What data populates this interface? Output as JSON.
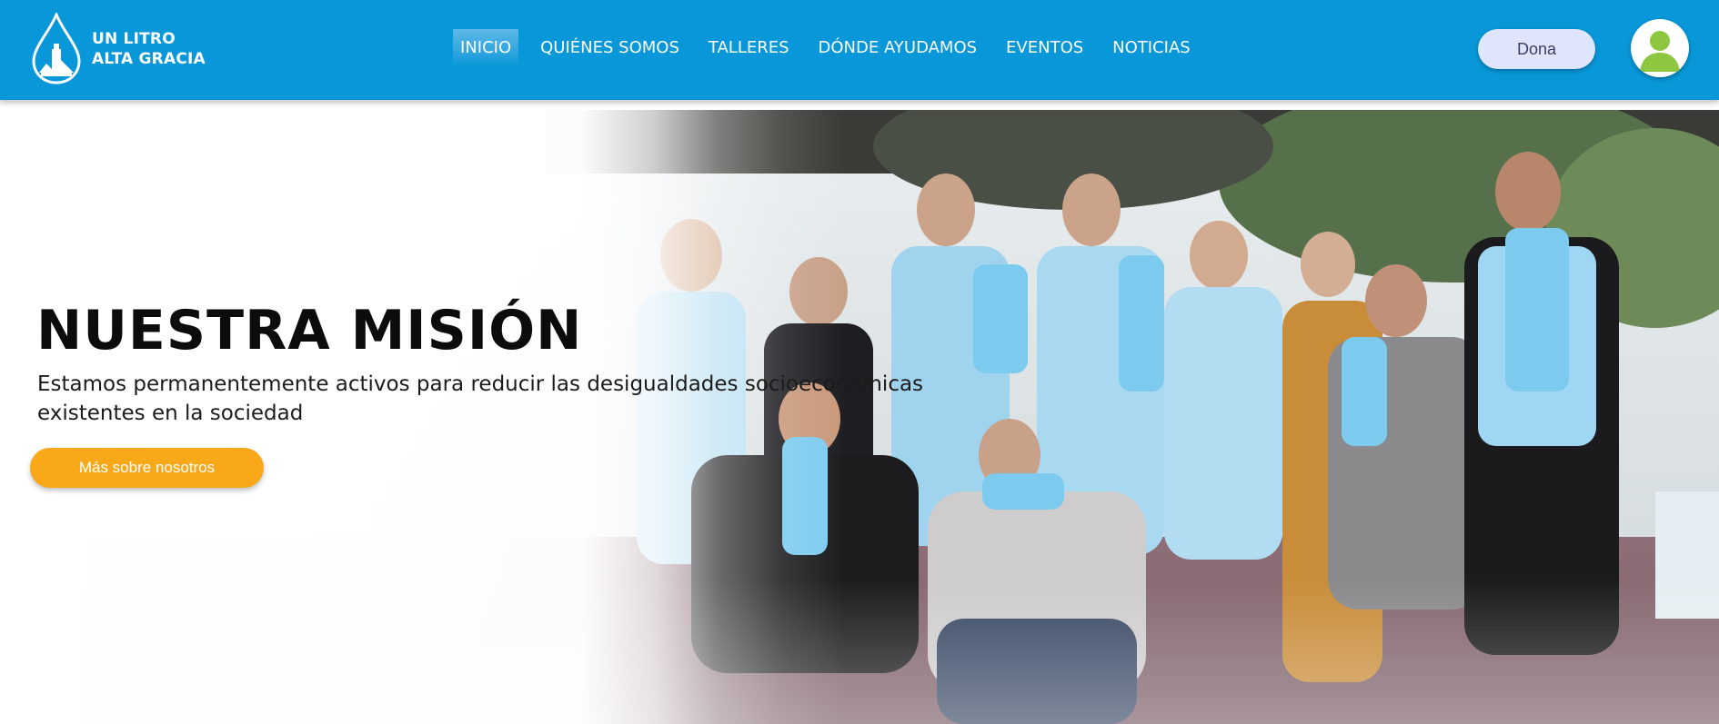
{
  "brand": {
    "line1": "UN LITRO",
    "line2": "ALTA GRACIA",
    "header_color": "#0897d8"
  },
  "nav": {
    "items": [
      {
        "label": "INICIO",
        "active": true
      },
      {
        "label": "QUIÉNES SOMOS",
        "active": false
      },
      {
        "label": "TALLERES",
        "active": false
      },
      {
        "label": "DÓNDE AYUDAMOS",
        "active": false
      },
      {
        "label": "EVENTOS",
        "active": false
      },
      {
        "label": "NOTICIAS",
        "active": false
      }
    ]
  },
  "header_actions": {
    "donate_label": "Dona",
    "avatar_icon": "user-avatar-icon"
  },
  "hero": {
    "title": "NUESTRA MISIÓN",
    "subtitle_line1": "Estamos permanentemente activos para reducir las desigualdades socioeconómicas",
    "subtitle_line2": "existentes en la sociedad",
    "cta_label": "Más sobre nosotros",
    "cta_color": "#f9a81a"
  }
}
